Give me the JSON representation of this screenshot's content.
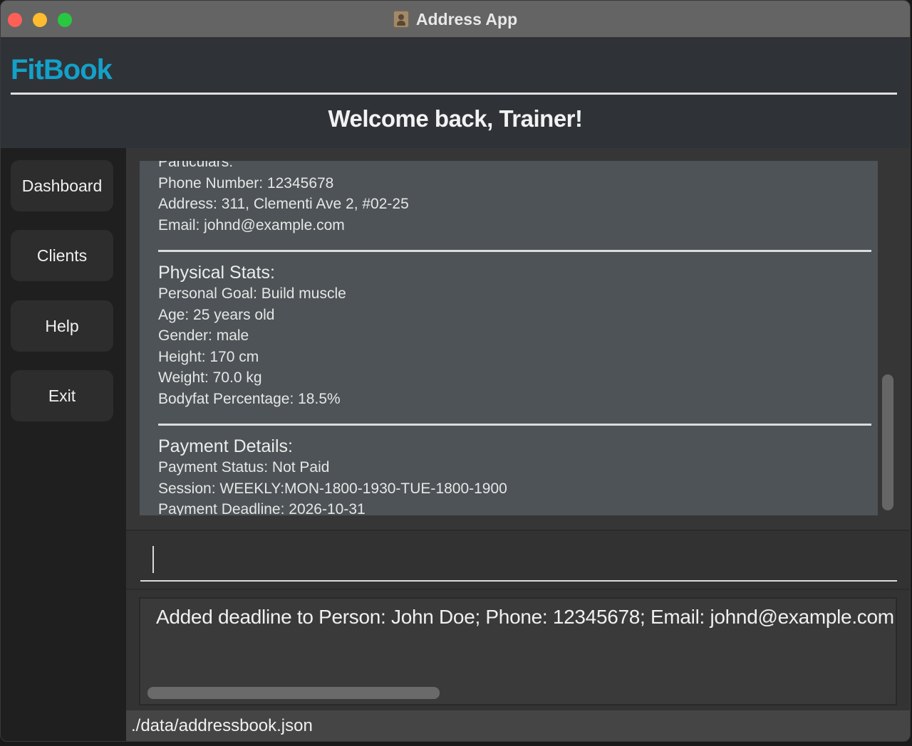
{
  "window": {
    "title": "Address App"
  },
  "header": {
    "brand": "FitBook",
    "welcome": "Welcome back, Trainer!"
  },
  "sidebar": {
    "items": [
      {
        "label": "Dashboard"
      },
      {
        "label": "Clients"
      },
      {
        "label": "Help"
      },
      {
        "label": "Exit"
      }
    ]
  },
  "client": {
    "particulars": {
      "title": "Particulars:",
      "phone": "Phone Number: 12345678",
      "address": "Address: 311, Clementi Ave 2, #02-25",
      "email": "Email: johnd@example.com"
    },
    "physical": {
      "title": "Physical Stats:",
      "goal": "Personal Goal: Build muscle",
      "age": "Age: 25 years old",
      "gender": "Gender: male",
      "height": "Height: 170 cm",
      "weight": "Weight: 70.0 kg",
      "bodyfat": "Bodyfat Percentage: 18.5%"
    },
    "payment": {
      "title": "Payment Details:",
      "status": "Payment Status: Not Paid",
      "session": "Session: WEEKLY:MON-1800-1930-TUE-1800-1900",
      "deadline": "Payment Deadline: 2026-10-31"
    }
  },
  "command": {
    "value": ""
  },
  "result": {
    "text": "Added deadline to Person: John Doe; Phone: 12345678; Email: johnd@example.com"
  },
  "status": {
    "path": "./data/addressbook.json"
  },
  "icons": {
    "app": "address-book-icon",
    "close": "close-traffic-light",
    "minimize": "minimize-traffic-light",
    "zoom": "zoom-traffic-light"
  },
  "colors": {
    "brand": "#14a0c8",
    "close": "#fe5f57",
    "minimize": "#febc2e",
    "zoom": "#28c840"
  }
}
